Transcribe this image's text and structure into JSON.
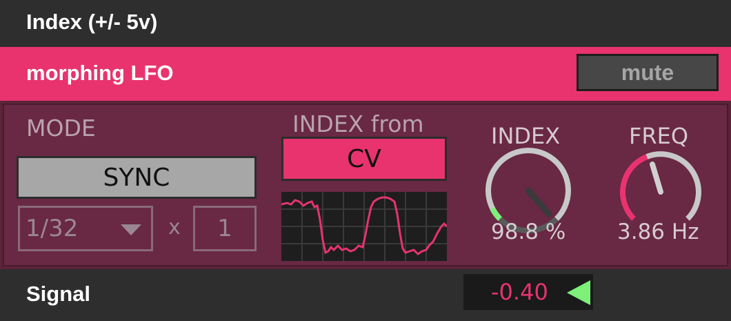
{
  "top": {
    "title": "Index (+/- 5v)"
  },
  "header": {
    "title": "morphing LFO",
    "mute_label": "mute"
  },
  "mode": {
    "label": "MODE",
    "sync_label": "SYNC",
    "division": "1/32",
    "multiplier_symbol": "x",
    "multiplier": "1"
  },
  "index_from": {
    "label": "INDEX from",
    "value": "CV"
  },
  "knobs": {
    "index": {
      "label": "INDEX",
      "value_text": "98.8 %",
      "value_percent": 98.8
    },
    "freq": {
      "label": "FREQ",
      "value_text": "3.86 Hz"
    }
  },
  "signal": {
    "label": "Signal",
    "value": "-0.40"
  },
  "colors": {
    "accent": "#e8336f",
    "panel": "#692843",
    "meter_arrow": "#7df07a",
    "background": "#2b2b2b"
  }
}
